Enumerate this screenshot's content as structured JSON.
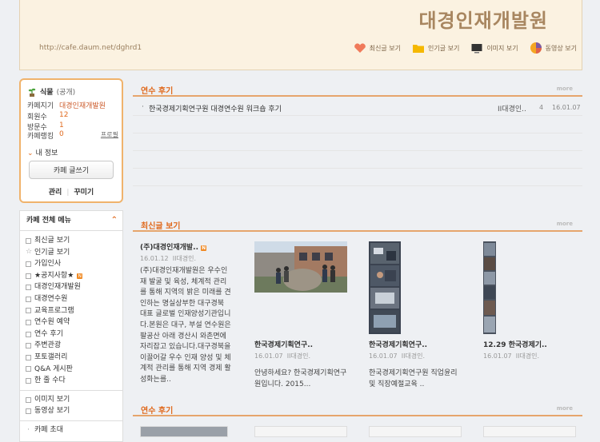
{
  "header": {
    "cafe_name": "대경인재개발원",
    "url": "http://cafe.daum.net/dghrd1",
    "nav": [
      {
        "label": "최신글 보기",
        "icon": "heart-icon"
      },
      {
        "label": "인기글 보기",
        "icon": "folder-icon"
      },
      {
        "label": "이미지 보기",
        "icon": "monitor-icon"
      },
      {
        "label": "동영상 보기",
        "icon": "pie-icon"
      }
    ]
  },
  "profile": {
    "grade": "식물",
    "visibility": "(공개)",
    "rows": [
      {
        "label": "카페지기",
        "value": "대경인재개발원"
      },
      {
        "label": "회원수",
        "value": "12"
      },
      {
        "label": "방문수",
        "value": "1"
      },
      {
        "label": "카페랭킹",
        "value": "0"
      }
    ],
    "profile_link": "프로필",
    "my_info": "내 정보",
    "write_button": "카페 글쓰기",
    "manage": "관리",
    "decorate": "꾸미기"
  },
  "menu": {
    "title": "카페 전체 메뉴",
    "items": [
      {
        "label": "최신글 보기",
        "icon": "square"
      },
      {
        "label": "인기글 보기",
        "icon": "star"
      },
      {
        "label": "가입인사",
        "icon": "square"
      },
      {
        "label": "★공지사항★",
        "icon": "square",
        "badge": "N"
      },
      {
        "label": "대경인재개발원",
        "icon": "square"
      },
      {
        "label": "대경연수원",
        "icon": "square"
      },
      {
        "label": "교육프로그램",
        "icon": "square"
      },
      {
        "label": "연수원 예약",
        "icon": "square"
      },
      {
        "label": "연수 후기",
        "icon": "square"
      },
      {
        "label": "주변관광",
        "icon": "square"
      },
      {
        "label": "포토갤러리",
        "icon": "square"
      },
      {
        "label": "Q&A 게시판",
        "icon": "square"
      },
      {
        "label": "한 줄 수다",
        "icon": "square"
      }
    ],
    "media_items": [
      {
        "label": "이미지 보기",
        "icon": "image"
      },
      {
        "label": "동영상 보기",
        "icon": "video"
      }
    ],
    "extra_items": [
      {
        "label": "카페 초대"
      }
    ]
  },
  "reviews_section": {
    "title": "연수 후기",
    "more": "more",
    "posts": [
      {
        "title": "한국경제기획연구원 대경연수원 워크숍 후기",
        "author": "II대경인..",
        "count": "4",
        "date": "16.01.07"
      }
    ]
  },
  "latest_section": {
    "title": "최신글 보기",
    "more": "more",
    "cards": [
      {
        "title": "(주)대경인재개발..",
        "date": "16.01.12",
        "author": "II대경인.",
        "body": "(주)대경인재개발원은 우수인재 발굴 및 육성, 체계적 관리를 통해 지역의 밝은 미래를 견인하는 명실상부한 대구경북 대표 글로벌 인재양성기관입니다.본원은 대구, 부설 연수원은 팔공산 아래 경산시 와촌면에 자리잡고 있습니다.대구경북을 이끌어갈 우수 인재 양성 및 체계적 관리를 통해 지역 경제 활성화는를..",
        "badge": "N"
      },
      {
        "title": "한국경제기획연구..",
        "date": "16.01.07",
        "author": "II대경인.",
        "body": "안녕하세요? 한국경제기획연구원입니다. 2015..."
      },
      {
        "title": "한국경제기획연구..",
        "date": "16.01.07",
        "author": "II대경인.",
        "body": "한국경제기획연구원 직업윤리 및 직장예절교육 .."
      },
      {
        "title": "12.29 한국경제기..",
        "date": "16.01.07",
        "author": "II대경인.",
        "body": ""
      }
    ]
  },
  "reviews_section2": {
    "title": "연수 후기",
    "more": "more"
  }
}
